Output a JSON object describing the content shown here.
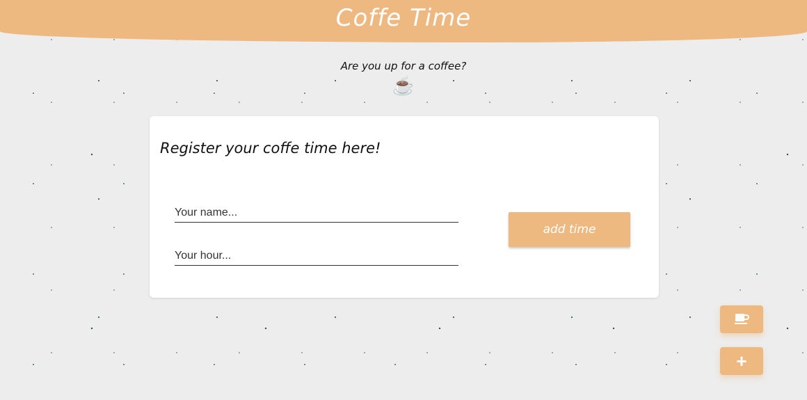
{
  "header": {
    "title": "Coffe Time"
  },
  "hero": {
    "tagline": "Are you up for a coffee?",
    "emoji": "☕"
  },
  "card": {
    "title": "Register your coffe time here!",
    "name_placeholder": "Your name...",
    "hour_placeholder": "Your hour...",
    "add_label": "add time"
  },
  "fabs": {
    "coffee_icon": "coffee-icon",
    "add_symbol": "+"
  },
  "colors": {
    "accent": "#eeb881",
    "background": "#ededed",
    "speckle": "#1d4a3b"
  }
}
